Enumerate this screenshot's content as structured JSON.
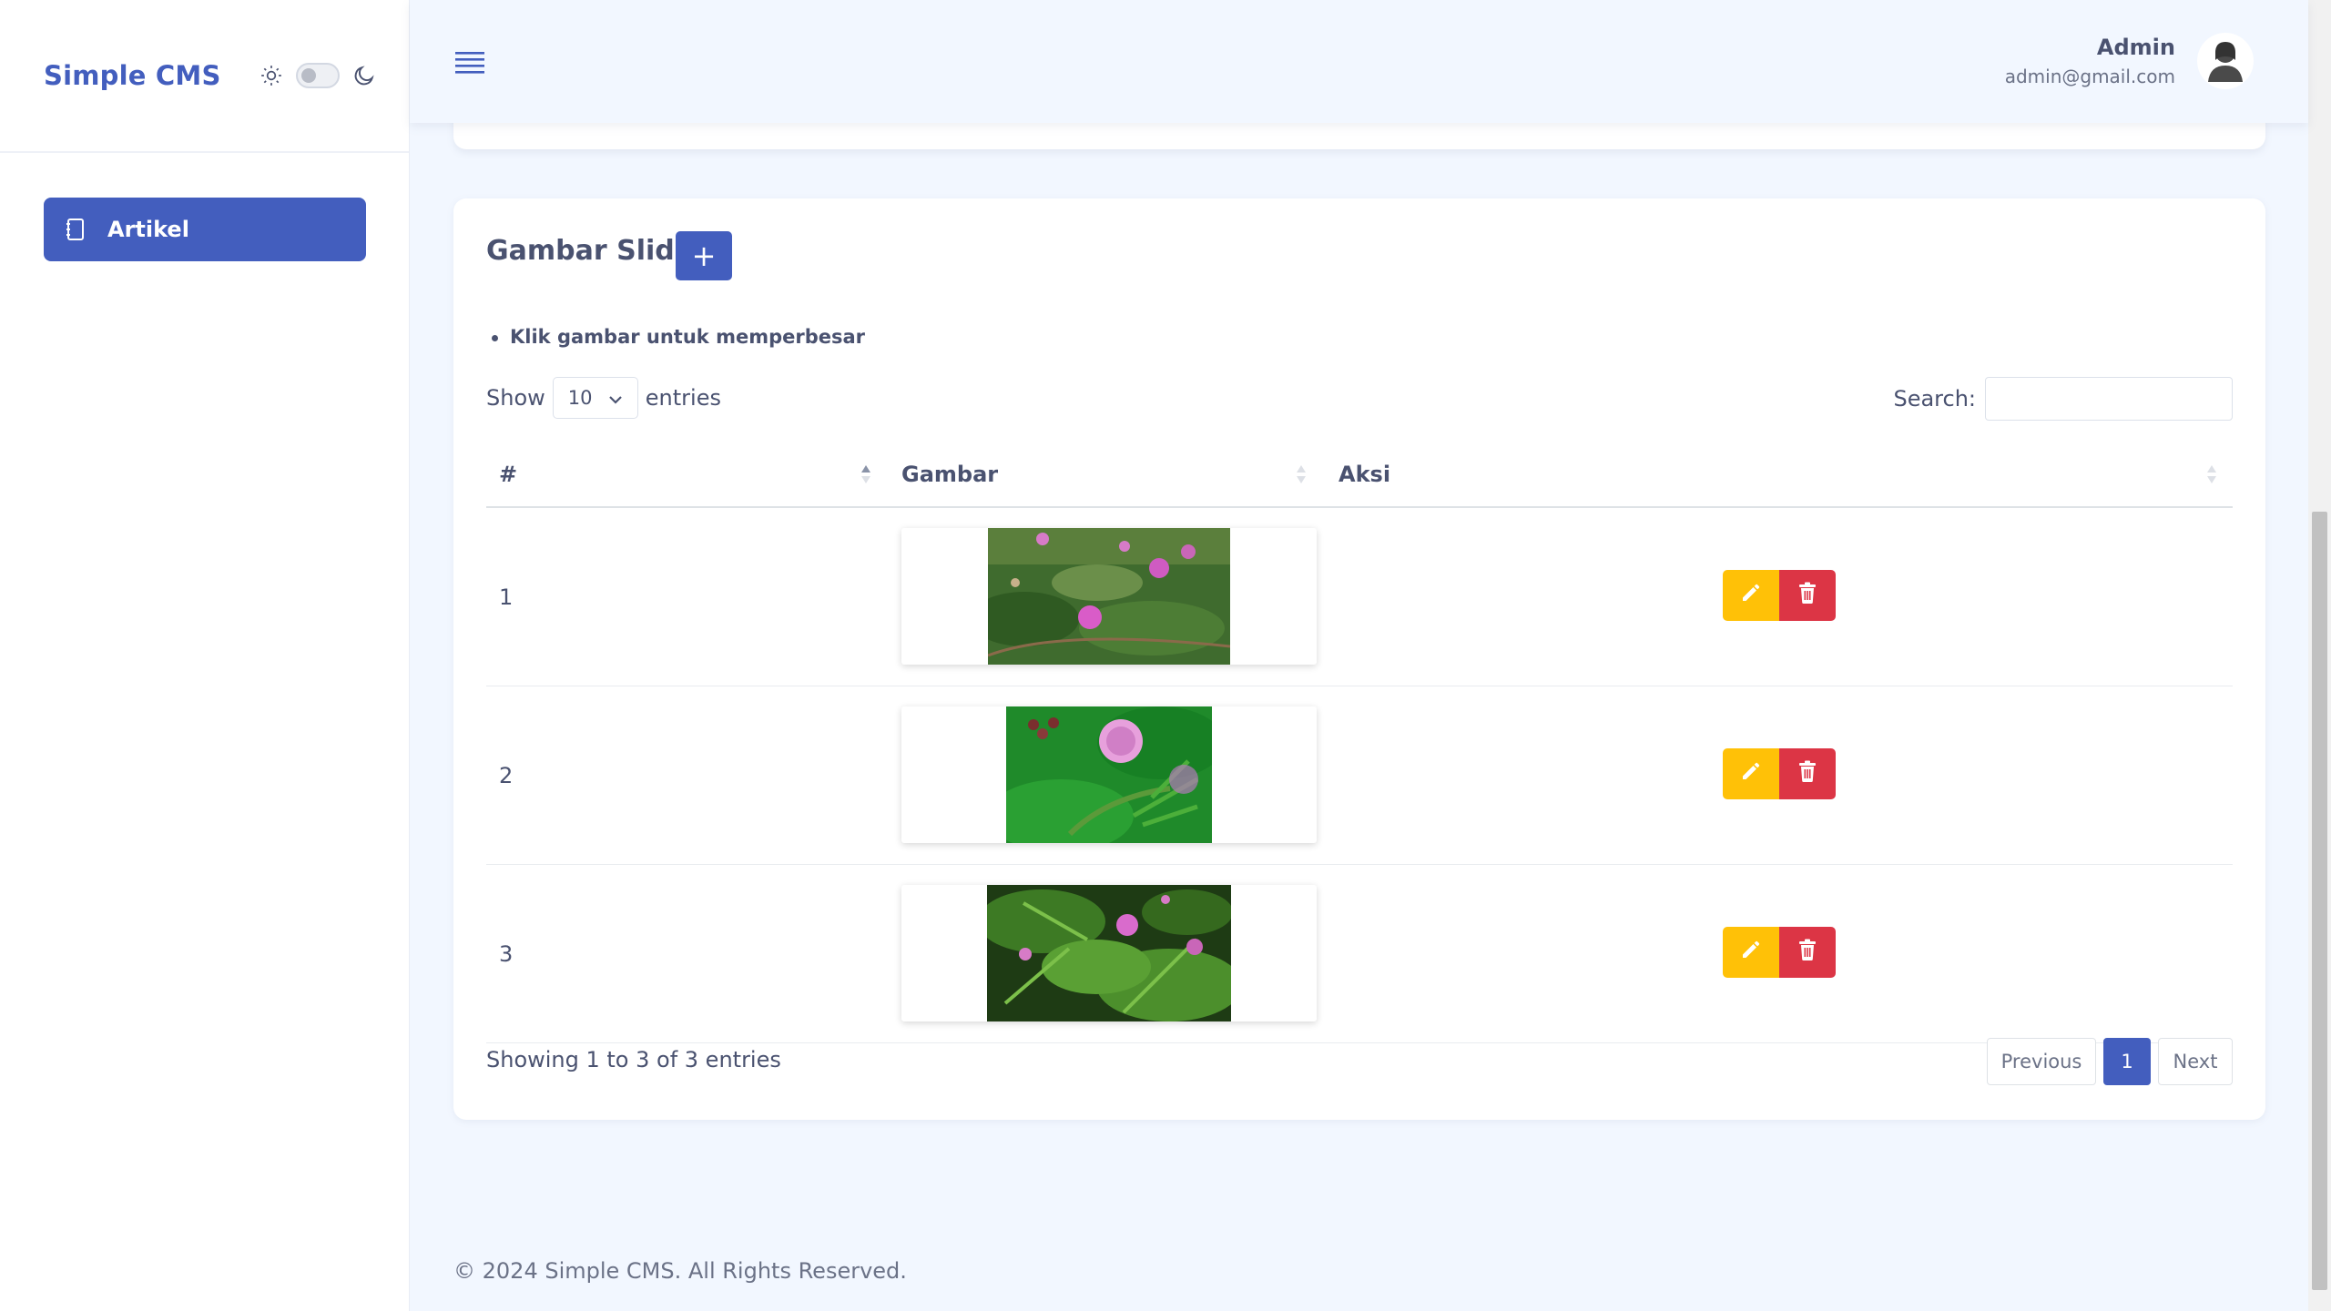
{
  "sidebar": {
    "brand": "Simple CMS",
    "theme_icons": [
      "sun-icon",
      "moon-icon"
    ],
    "items": [
      {
        "label": "Artikel",
        "icon": "journal-icon",
        "active": true
      }
    ]
  },
  "header": {
    "user_name": "Admin",
    "user_email": "admin@gmail.com"
  },
  "card": {
    "title": "Gambar Slider",
    "add_label": "+",
    "hint": "Klik gambar untuk memperbesar",
    "show_label": "Show",
    "entries_label": "entries",
    "page_length": "10",
    "search_label": "Search:",
    "search_value": ""
  },
  "table": {
    "columns": [
      "#",
      "Gambar",
      "Aksi"
    ],
    "rows": [
      {
        "num": "1"
      },
      {
        "num": "2"
      },
      {
        "num": "3"
      }
    ]
  },
  "pagination": {
    "info": "Showing 1 to 3 of 3 entries",
    "previous": "Previous",
    "current": "1",
    "next": "Next"
  },
  "footer": {
    "text": "© 2024 Simple CMS. All Rights Reserved."
  },
  "colors": {
    "primary": "#435ebe",
    "edit": "#ffc107",
    "delete": "#dc3545",
    "background": "#f2f7ff"
  }
}
